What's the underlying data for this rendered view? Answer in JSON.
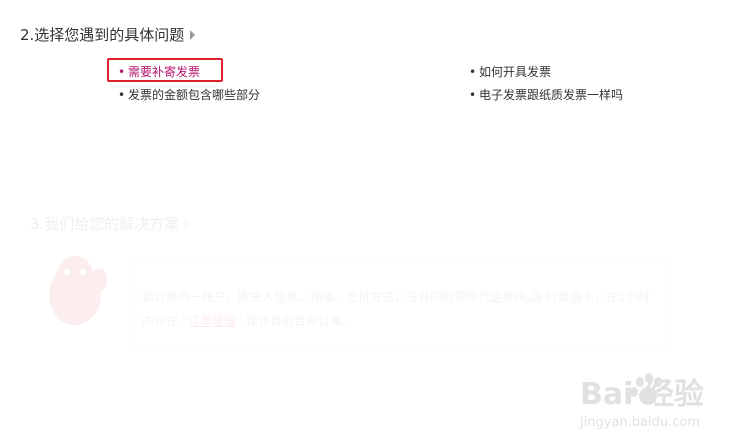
{
  "step2": {
    "title": "2.选择您遇到的具体问题"
  },
  "questions": [
    {
      "label": "需要补寄发票",
      "active": true
    },
    {
      "label": "如何开具发票",
      "active": false
    },
    {
      "label": "发票的金额包含哪些部分",
      "active": false
    },
    {
      "label": "电子发票跟纸质发票一样吗",
      "active": false
    }
  ],
  "step3": {
    "title": "3.我们给您的解决方案",
    "answer_line1": "如订单同一账户、收货人信息、预道、支付方式，没有同时使用代金券/礼品卡/雌品卡，在1小时",
    "answer_pre": "内可在 “",
    "answer_link": "订单管理",
    "answer_post": "” 操作自助合并订单。"
  },
  "watermark": {
    "brand": "Bai 经验",
    "url": "jingyan.baidu.com"
  },
  "colors": {
    "active_question": "#b4166d",
    "highlight_border": "#e0222e"
  },
  "icons": [
    "chevron-right-icon",
    "mascot-icon",
    "baidu-paw-logo"
  ]
}
